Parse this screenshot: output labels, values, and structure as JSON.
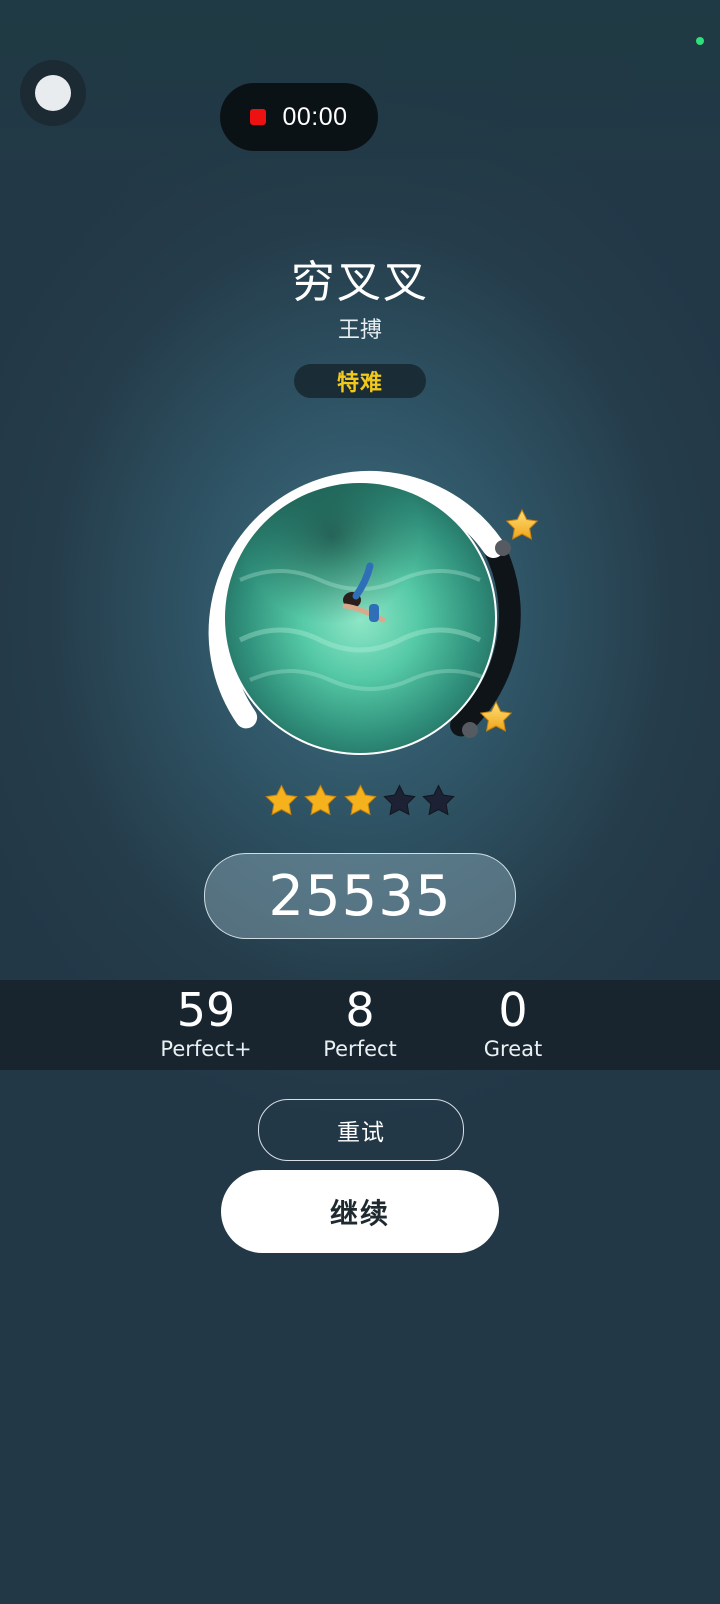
{
  "status": {
    "record_time": "00:00"
  },
  "song": {
    "title": "穷叉叉",
    "artist": "王搏",
    "difficulty": "特难"
  },
  "rating": {
    "stars_earned": 3,
    "stars_total": 5
  },
  "score": "25535",
  "judgements": [
    {
      "count": "59",
      "label": "Perfect+"
    },
    {
      "count": "8",
      "label": "Perfect"
    },
    {
      "count": "0",
      "label": "Great"
    }
  ],
  "buttons": {
    "retry": "重试",
    "continue": "继续"
  },
  "colors": {
    "difficulty_text": "#f2c81a",
    "star_gold": "#f6b21d",
    "star_empty": "#1c2233",
    "record_dot": "#ee1111",
    "progress_arc": "#ffffff"
  },
  "icons": {
    "floating_ball": "floating-ball-icon",
    "record": "record-dot-icon",
    "star": "star-icon"
  }
}
